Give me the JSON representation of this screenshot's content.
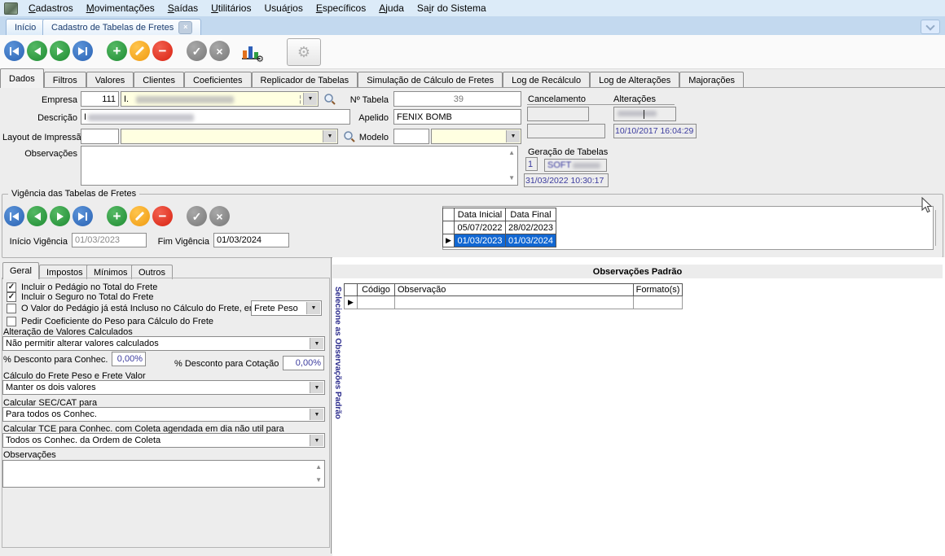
{
  "icons": {
    "dropdown": "▼",
    "scroll_up": "▲",
    "scroll_down": "▼",
    "check": "✓",
    "close": "×",
    "plus": "+",
    "minus": "−",
    "gear": "⚙",
    "row_marker": "▶",
    "combo_divider": "¦"
  },
  "menubar": {
    "items": [
      {
        "pre": "",
        "u": "C",
        "rest": "adastros"
      },
      {
        "pre": "",
        "u": "M",
        "rest": "ovimentações"
      },
      {
        "pre": "",
        "u": "S",
        "rest": "aídas"
      },
      {
        "pre": "",
        "u": "U",
        "rest": "tilitários"
      },
      {
        "pre": "Usuá",
        "u": "r",
        "rest": "ios"
      },
      {
        "pre": "",
        "u": "E",
        "rest": "specíficos"
      },
      {
        "pre": "",
        "u": "A",
        "rest": "juda"
      },
      {
        "pre": "Sa",
        "u": "i",
        "rest": "r do Sistema"
      }
    ]
  },
  "tabstrip": {
    "home_tab": "Início",
    "active_tab": "Cadastro de Tabelas de Fretes"
  },
  "main_tabs": [
    "Dados",
    "Filtros",
    "Valores",
    "Clientes",
    "Coeficientes",
    "Replicador de Tabelas",
    "Simulação de Cálculo de Fretes",
    "Log de Recálculo",
    "Log de Alterações",
    "Majorações"
  ],
  "form": {
    "empresa": {
      "label": "Empresa",
      "code": "111",
      "name": "I."
    },
    "n_tabela": {
      "label": "Nº Tabela",
      "value": "39"
    },
    "descricao": {
      "label": "Descrição",
      "value": "I"
    },
    "apelido": {
      "label": "Apelido",
      "value": "FENIX BOMB"
    },
    "layout": {
      "label": "Layout de Impressão"
    },
    "modelo": {
      "label": "Modelo"
    },
    "observacoes": {
      "label": "Observações",
      "value": ""
    },
    "cancelamento": {
      "label": "Cancelamento"
    },
    "alteracoes": {
      "label": "Alterações",
      "datetime": "10/10/2017 16:04:29"
    },
    "geracao": {
      "label": "Geração de Tabelas",
      "numero": "1",
      "usuario": "SOFT",
      "datetime": "31/03/2022 10:30:17"
    }
  },
  "vigencia": {
    "title": "Vigência das Tabelas de Fretes",
    "inicio": {
      "label": "Início Vigência",
      "value": "01/03/2023"
    },
    "fim": {
      "label": "Fim Vigência",
      "value": "01/03/2024"
    },
    "grid": {
      "col_inicio": "Data Inicial",
      "col_fim": "Data Final",
      "rows": [
        {
          "marker": "",
          "inicio": "05/07/2022",
          "fim": "28/02/2023"
        },
        {
          "marker": "▶",
          "inicio": "01/03/2023",
          "fim": "01/03/2024"
        }
      ]
    }
  },
  "sub_tabs": [
    "Geral",
    "Impostos",
    "Mínimos",
    "Outros"
  ],
  "geral": {
    "checkboxes": [
      {
        "glyph": "✓",
        "label": "Incluir o Pedágio no Total do Frete"
      },
      {
        "glyph": "✓",
        "label": "Incluir o Seguro no Total do Frete"
      },
      {
        "glyph": "",
        "label": "O Valor do Pedágio já está Incluso no Cálculo do Frete, em"
      },
      {
        "glyph": "",
        "label": "Pedir Coeficiente do Peso para Cálculo do Frete"
      }
    ],
    "pedagio_tipo": {
      "value": "Frete Peso"
    },
    "alteracao_valores": {
      "label": "Alteração de Valores Calculados",
      "value": "Não permitir alterar valores calculados"
    },
    "desconto_conhec": {
      "label": "% Desconto para Conhec.",
      "value": "0,00%"
    },
    "desconto_cotacao": {
      "label": "% Desconto para Cotação",
      "value": "0,00%"
    },
    "calculo_frete": {
      "label": "Cálculo do Frete Peso e Frete Valor",
      "value": "Manter os dois valores"
    },
    "sec_cat": {
      "label": "Calcular SEC/CAT para",
      "value": "Para todos os Conhec."
    },
    "tce": {
      "label": "Calcular TCE para Conhec. com  Coleta agendada em dia não util para",
      "value": "Todos os Conhec. da Ordem de Coleta"
    },
    "observacoes": {
      "label": "Observações",
      "value": ""
    }
  },
  "obs_padrao": {
    "title": "Observações Padrão",
    "side_label": "Selecione as Observações Padrão",
    "col_codigo": "Código",
    "col_observacao": "Observação",
    "col_formato": "Formato(s)",
    "row_marker": "▶"
  }
}
